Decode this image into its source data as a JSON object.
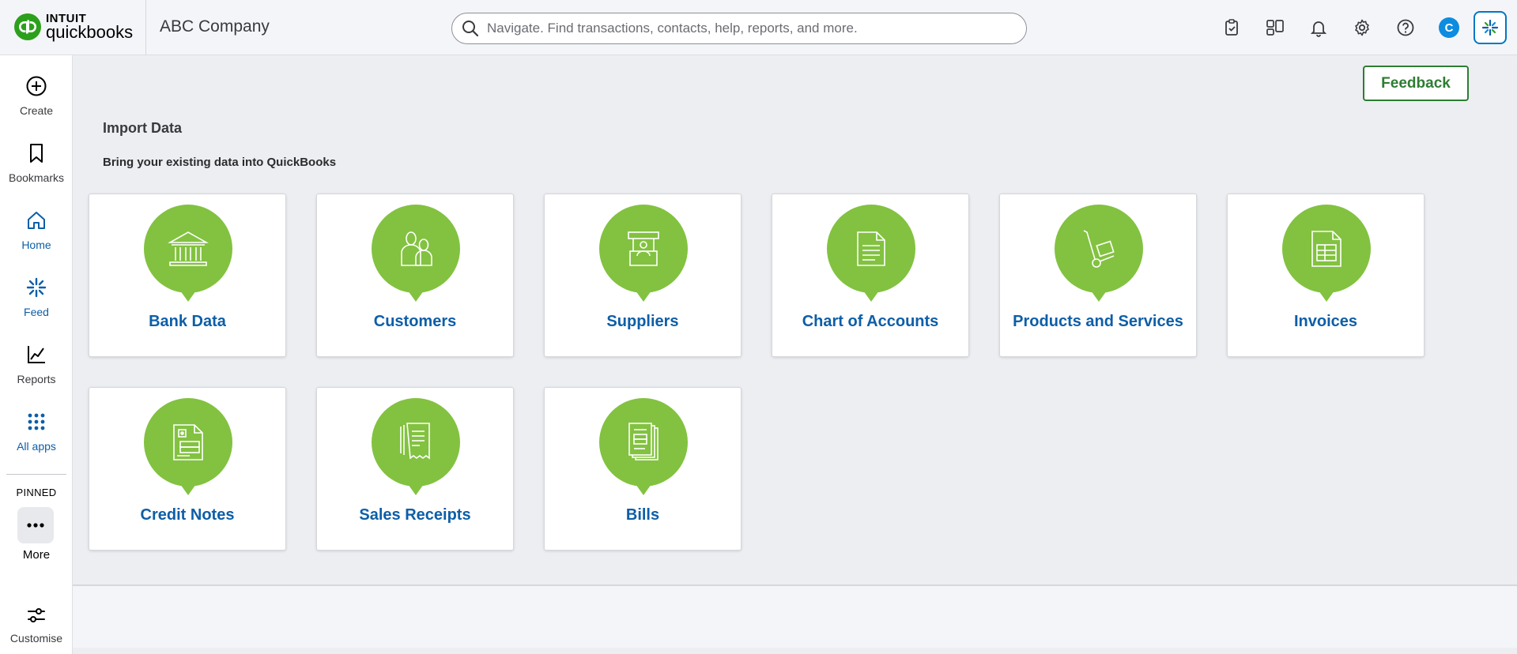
{
  "brand": {
    "line1": "INTUIT",
    "line2": "quickbooks",
    "color": "#2ca01c"
  },
  "company": "ABC Company",
  "search": {
    "placeholder": "Navigate. Find transactions, contacts, help, reports, and more."
  },
  "top_icons": [
    "tasks-icon",
    "apps-switcher-icon",
    "bell-icon",
    "gear-icon",
    "help-icon"
  ],
  "avatar_letter": "C",
  "sidebar": {
    "items": [
      {
        "label": "Create",
        "icon": "plus-circle-icon"
      },
      {
        "label": "Bookmarks",
        "icon": "bookmark-icon"
      },
      {
        "label": "Home",
        "icon": "home-icon"
      },
      {
        "label": "Feed",
        "icon": "feed-icon"
      },
      {
        "label": "Reports",
        "icon": "chart-line-icon"
      },
      {
        "label": "All apps",
        "icon": "grid-icon"
      }
    ],
    "pinned_label": "PINNED",
    "more_label": "More",
    "customise_label": "Customise"
  },
  "feedback_label": "Feedback",
  "page": {
    "title": "Import Data",
    "subtitle": "Bring your existing data into QuickBooks"
  },
  "cards": [
    {
      "label": "Bank Data",
      "icon": "bank-icon"
    },
    {
      "label": "Customers",
      "icon": "customers-icon"
    },
    {
      "label": "Suppliers",
      "icon": "supplier-icon"
    },
    {
      "label": "Chart of Accounts",
      "icon": "document-icon"
    },
    {
      "label": "Products and Services",
      "icon": "hand-truck-icon"
    },
    {
      "label": "Invoices",
      "icon": "invoice-icon"
    },
    {
      "label": "Credit Notes",
      "icon": "credit-note-icon"
    },
    {
      "label": "Sales Receipts",
      "icon": "receipt-icon"
    },
    {
      "label": "Bills",
      "icon": "bills-icon"
    }
  ],
  "colors": {
    "accent_green": "#82c240",
    "link_blue": "#0d5ea8",
    "feedback_green": "#2e7d32"
  }
}
